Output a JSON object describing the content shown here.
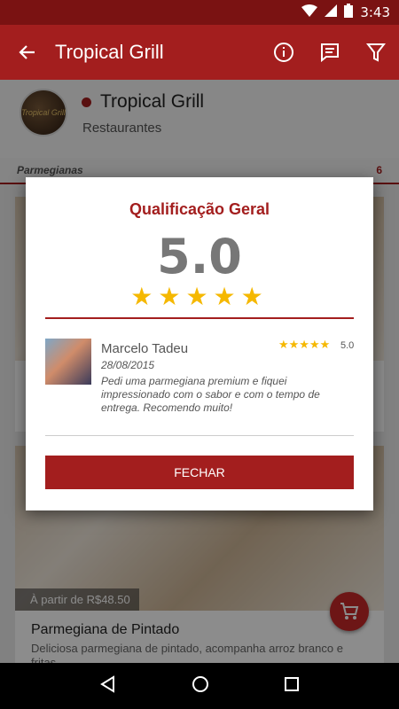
{
  "status_bar": {
    "time": "3:43"
  },
  "app_bar": {
    "title": "Tropical Grill"
  },
  "restaurant": {
    "name": "Tropical Grill",
    "category": "Restaurantes",
    "logo_text": "Tropical Grill"
  },
  "section": {
    "label": "Parmegianas",
    "count": "6"
  },
  "items": [
    {
      "title": "",
      "price": "",
      "description": ""
    },
    {
      "title": "Parmegiana de Pintado",
      "price": "À partir de R$48.50",
      "description": "Deliciosa parmegiana de pintado, acompanha arroz branco e fritas."
    }
  ],
  "dialog": {
    "title": "Qualificação Geral",
    "score": "5.0",
    "stars": "★★★★★",
    "review": {
      "name": "Marcelo Tadeu",
      "date": "28/08/2015",
      "stars": "★★★★★",
      "score": "5.0",
      "text": "Pedi uma parmegiana premium e fiquei impressionado com o sabor e com o tempo de entrega. Recomendo muito!"
    },
    "button_label": "FECHAR"
  },
  "colors": {
    "primary": "#a31e1e",
    "primary_dark": "#7a1212",
    "star": "#f5b800"
  }
}
